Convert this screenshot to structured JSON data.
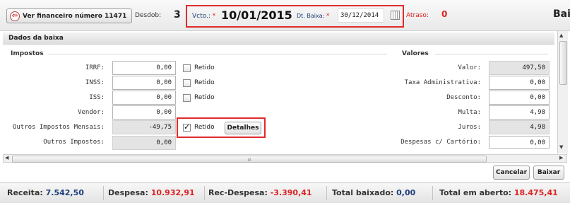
{
  "header": {
    "ver_button_label": "Ver financeiro número 11471",
    "desdob_label": "Desdob:",
    "desdob_value": "3",
    "vcto_label": "Vcto.:",
    "vcto_value": "10/01/2015",
    "baixa_label": "Dt. Baixa:",
    "baixa_value": "30/12/2014",
    "atraso_label": "Atraso:",
    "atraso_value": "0",
    "right_title": "Bai",
    "required_mark": "*"
  },
  "section_title": "Dados da baixa",
  "impostos": {
    "legend": "Impostos",
    "rows": [
      {
        "label": "IRRF:",
        "value": "0,00",
        "retido": "Retido"
      },
      {
        "label": "INSS:",
        "value": "0,00",
        "retido": "Retido"
      },
      {
        "label": "ISS:",
        "value": "0,00",
        "retido": "Retido"
      },
      {
        "label": "Vendor:",
        "value": "0,00"
      },
      {
        "label": "Outros Impostos Mensais:",
        "value": "-49,75",
        "retido": "Retido",
        "checked": true
      },
      {
        "label": "Outros Impostos:",
        "value": "0,00"
      }
    ],
    "detalhes_label": "Detalhes"
  },
  "valores": {
    "legend": "Valores",
    "rows": [
      {
        "label": "Valor:",
        "value": "497,50"
      },
      {
        "label": "Taxa Administrativa:",
        "value": "0,00"
      },
      {
        "label": "Desconto:",
        "value": "0,00"
      },
      {
        "label": "Multa:",
        "value": "4,98"
      },
      {
        "label": "Juros:",
        "value": "4,98"
      },
      {
        "label": "Despesas c/ Cartório:",
        "value": "0,00"
      }
    ]
  },
  "scrollbar_grip": "III",
  "actions": {
    "cancelar_label": "Cancelar",
    "baixar_label": "Baixar"
  },
  "footer": {
    "receita_label": "Receita:",
    "receita_value": "7.542,50",
    "despesa_label": "Despesa:",
    "despesa_value": "10.932,91",
    "recdesp_label": "Rec-Despesa:",
    "recdesp_value": "-3.390,41",
    "total_baixado_label": "Total baixado:",
    "total_baixado_value": "0,00",
    "total_aberto_label": "Total em aberto:",
    "total_aberto_value": "18.475,41"
  },
  "colors": {
    "accent_red": "#d22222",
    "footer_blue": "#1d3f7a",
    "highlight_border": "#e02b2b"
  }
}
